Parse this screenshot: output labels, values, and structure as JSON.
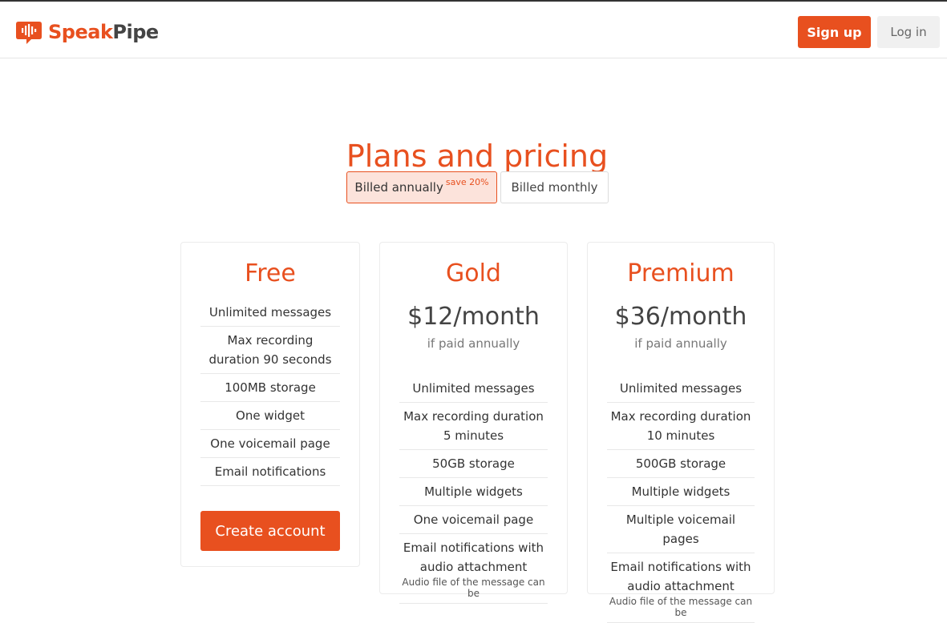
{
  "header": {
    "logo_speak": "Speak",
    "logo_pipe": "Pipe",
    "signup_label": "Sign up",
    "login_label": "Log in"
  },
  "colors": {
    "accent": "#e8501f",
    "accent_light": "#fce3db",
    "text": "#333333"
  },
  "pricing": {
    "title": "Plans and pricing",
    "billing_toggle": {
      "annual_label": "Billed annually",
      "annual_badge": "save 20%",
      "monthly_label": "Billed monthly",
      "selected": "annual"
    }
  },
  "plans": [
    {
      "name": "Free",
      "features": [
        "Unlimited messages",
        "Max recording duration 90 seconds",
        "100MB storage",
        "One widget",
        "One voicemail page",
        "Email notifications"
      ],
      "cta": "Create account"
    },
    {
      "name": "Gold",
      "price": "$12/month",
      "price_note": "if paid annually",
      "features": [
        "Unlimited messages",
        "Max recording duration 5 minutes",
        "50GB storage",
        "Multiple widgets",
        "One voicemail page",
        "Email notifications with audio attachment"
      ],
      "feature_note": "Audio file of the message can be"
    },
    {
      "name": "Premium",
      "price": "$36/month",
      "price_note": "if paid annually",
      "features": [
        "Unlimited messages",
        "Max recording duration 10 minutes",
        "500GB storage",
        "Multiple widgets",
        "Multiple voicemail pages",
        "Email notifications with audio attachment"
      ],
      "feature_note": "Audio file of the message can be"
    }
  ]
}
